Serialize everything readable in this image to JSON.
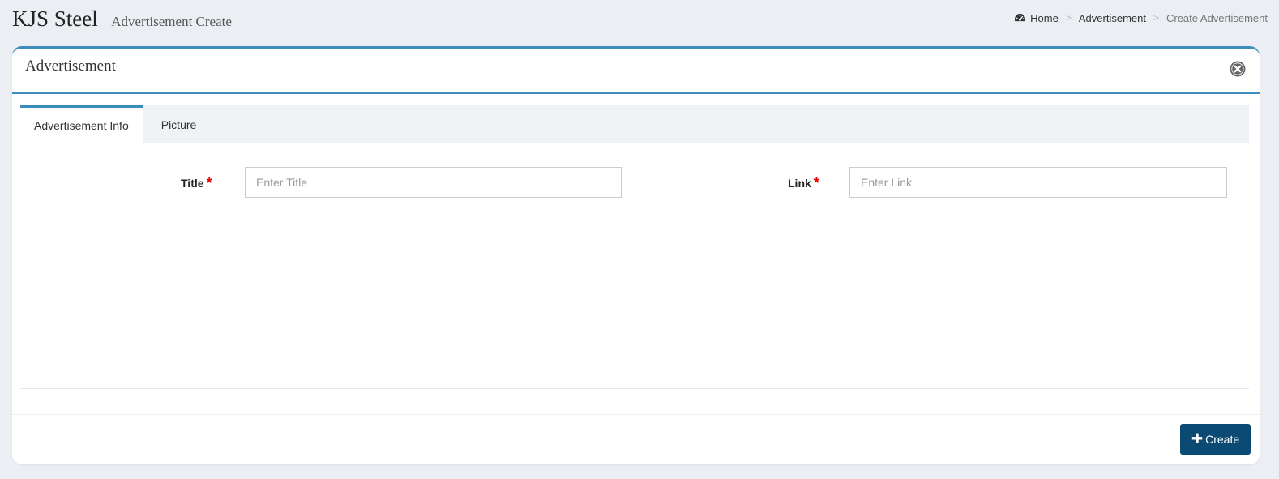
{
  "header": {
    "title": "KJS Steel",
    "subtitle": "Advertisement Create"
  },
  "breadcrumb": {
    "home": "Home",
    "section": "Advertisement",
    "current": "Create Advertisement",
    "separator": ">"
  },
  "panel": {
    "title": "Advertisement"
  },
  "tabs": [
    {
      "label": "Advertisement Info",
      "active": true
    },
    {
      "label": "Picture",
      "active": false
    }
  ],
  "form": {
    "title_label": "Title",
    "title_placeholder": "Enter Title",
    "title_value": "",
    "link_label": "Link",
    "link_placeholder": "Enter Link",
    "link_value": "",
    "required_mark": "*"
  },
  "footer": {
    "create_label": "Create",
    "create_icon": "plus-icon"
  },
  "colors": {
    "accent": "#3c8dbc",
    "button": "#0b4a73",
    "required": "#ee0000",
    "background": "#ebeef2"
  }
}
